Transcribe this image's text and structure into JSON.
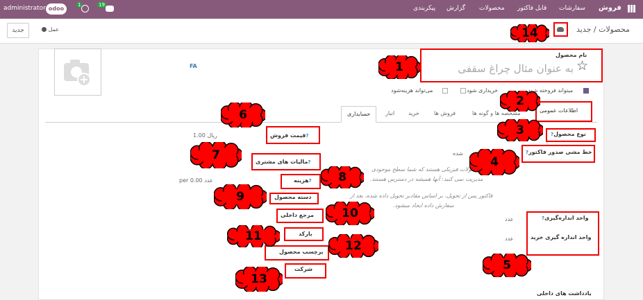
{
  "topbar": {
    "user": "administrator",
    "brand": "odoo",
    "badge_activity": "1",
    "badge_messages": "19",
    "app_title": "فروش",
    "menu": [
      "سفارشات",
      "قابل فاکتور",
      "محصولات",
      "گزارش",
      "پیکربندی"
    ]
  },
  "control": {
    "new_label": "جدید",
    "action_label": "عمل",
    "breadcrumb": "محصولات / جدید"
  },
  "form": {
    "image_alt": "camera",
    "lang": "FA",
    "name_label": "نام محصول",
    "name_placeholder": "به عنوان مثال چراغ سقفی",
    "check_sale": "میتواند فروخته شود",
    "check_purchase": "خریداری شود",
    "check_expense": "می‌تواند هزینه‌شود",
    "tabs": [
      "اطلاعات عمومی",
      "مشخصه ها و گونه ها",
      "فروش ها",
      "خرید",
      "انبار",
      "حسابداری"
    ],
    "product_type": "نوع محصول",
    "invoice_policy": "خط مشی صدور فاکتور",
    "uom": "واحد اندازه‌گیری",
    "uom_purchase": "واحد اندازه گیری خرید",
    "uom_value": "عدد",
    "uom_purchase_value": "عدد",
    "sale_price": "قیمت فروش",
    "sale_price_value": "1.00 ریال",
    "customer_taxes": "مالیات های مشتری",
    "cost": "هزینه",
    "cost_value": "per 0.00 عدد",
    "category": "دسته محصول",
    "internal_ref": "مرجع داخلی",
    "barcode": "بارکد",
    "product_tag": "برچسب محصول",
    "company": "شرکت",
    "delivered_fragment": "شده",
    "help_line1": "محصولات فیزیکی هستند که شما سطح موجودی",
    "help_line2": "مدیریت نمی کنید: آنها همیشه در دسترس هستند.",
    "help_line3": "فاکتور پس از تحویل، بر اساس مقادیر تحویل داده شده، بعد از",
    "help_line4": "سفارش داده ایجاد میشود.",
    "internal_notes": "یادداشت های داخلی"
  },
  "callouts": [
    "1",
    "2",
    "3",
    "4",
    "5",
    "6",
    "7",
    "8",
    "9",
    "10",
    "11",
    "12",
    "13",
    "14"
  ],
  "colors": {
    "topbar": "#875a7b",
    "callout_fill": "#ff0000",
    "box_border": "#ee0000"
  }
}
